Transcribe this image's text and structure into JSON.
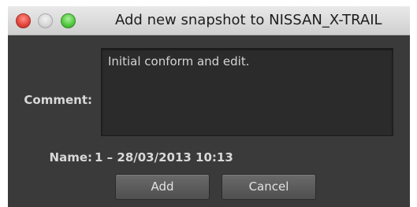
{
  "window": {
    "title": "Add new snapshot to NISSAN_X-TRAIL",
    "controls": [
      "close",
      "minimize",
      "zoom"
    ]
  },
  "form": {
    "comment_label": "Comment:",
    "comment_value": "Initial conform and edit.",
    "name_label": "Name:",
    "name_value": "1 – 28/03/2013 10:13"
  },
  "buttons": {
    "add_label": "Add",
    "cancel_label": "Cancel"
  },
  "colors": {
    "window_bg": "#3a3a3a",
    "close": "#e0443a",
    "minimize": "#d6d6d6",
    "zoom": "#4fc83c"
  }
}
